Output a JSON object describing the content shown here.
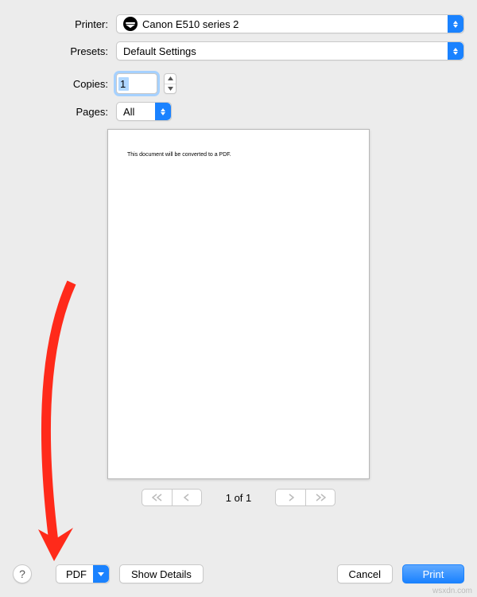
{
  "labels": {
    "printer": "Printer:",
    "presets": "Presets:",
    "copies": "Copies:",
    "pages": "Pages:"
  },
  "printer": {
    "name": "Canon E510 series 2"
  },
  "presets": {
    "value": "Default Settings"
  },
  "copies": {
    "value": "1"
  },
  "pages": {
    "value": "All"
  },
  "preview": {
    "doc_text": "This document will be converted to a PDF.",
    "page_indicator": "1 of 1"
  },
  "bottom": {
    "pdf": "PDF",
    "show_details": "Show Details",
    "cancel": "Cancel",
    "print": "Print",
    "help": "?"
  },
  "watermark": "wsxdn.com"
}
